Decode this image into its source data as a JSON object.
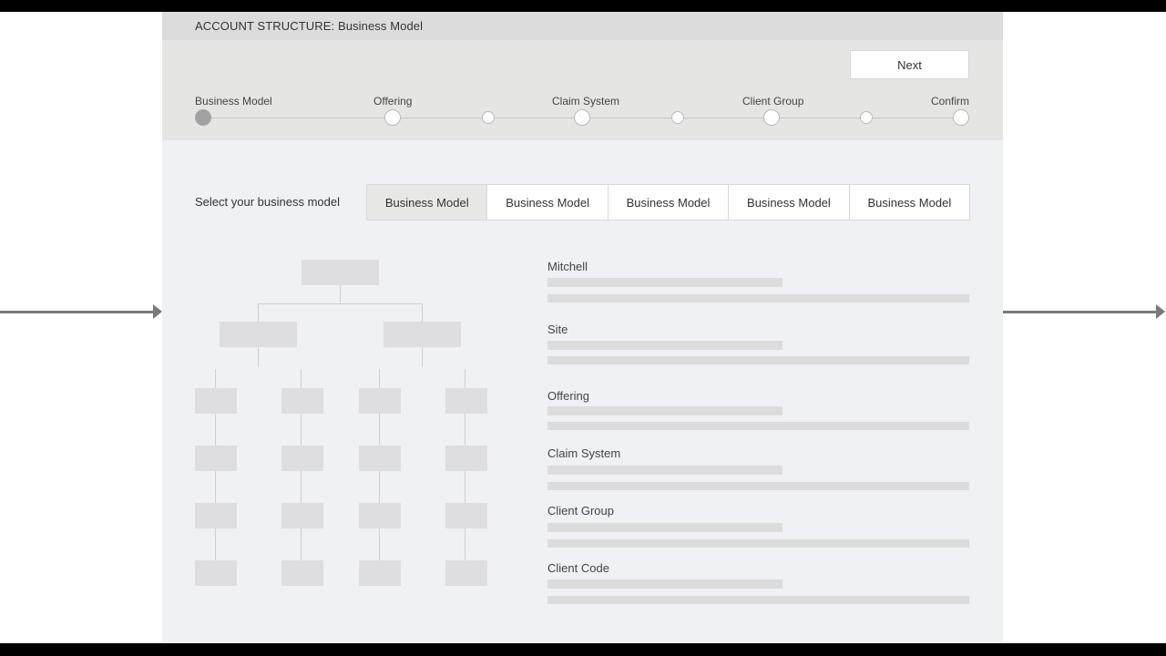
{
  "header": {
    "title": "ACCOUNT STRUCTURE: Business Model"
  },
  "toolbar": {
    "next_label": "Next"
  },
  "stepper": {
    "steps": [
      "Business Model",
      "Offering",
      "Claim System",
      "Client Group",
      "Confirm"
    ],
    "active_index": 0
  },
  "selector": {
    "label": "Select your business model",
    "tabs": [
      "Business Model",
      "Business Model",
      "Business Model",
      "Business Model",
      "Business Model"
    ],
    "selected_index": 0
  },
  "fields": [
    {
      "label": "Mitchell"
    },
    {
      "label": "Site"
    },
    {
      "label": "Offering"
    },
    {
      "label": "Claim System"
    },
    {
      "label": "Client Group"
    },
    {
      "label": "Client Code"
    }
  ],
  "colors": {
    "accent_active": "#a3a3a3",
    "panel": "#f0f1f4",
    "header": "#dcdcdd"
  }
}
